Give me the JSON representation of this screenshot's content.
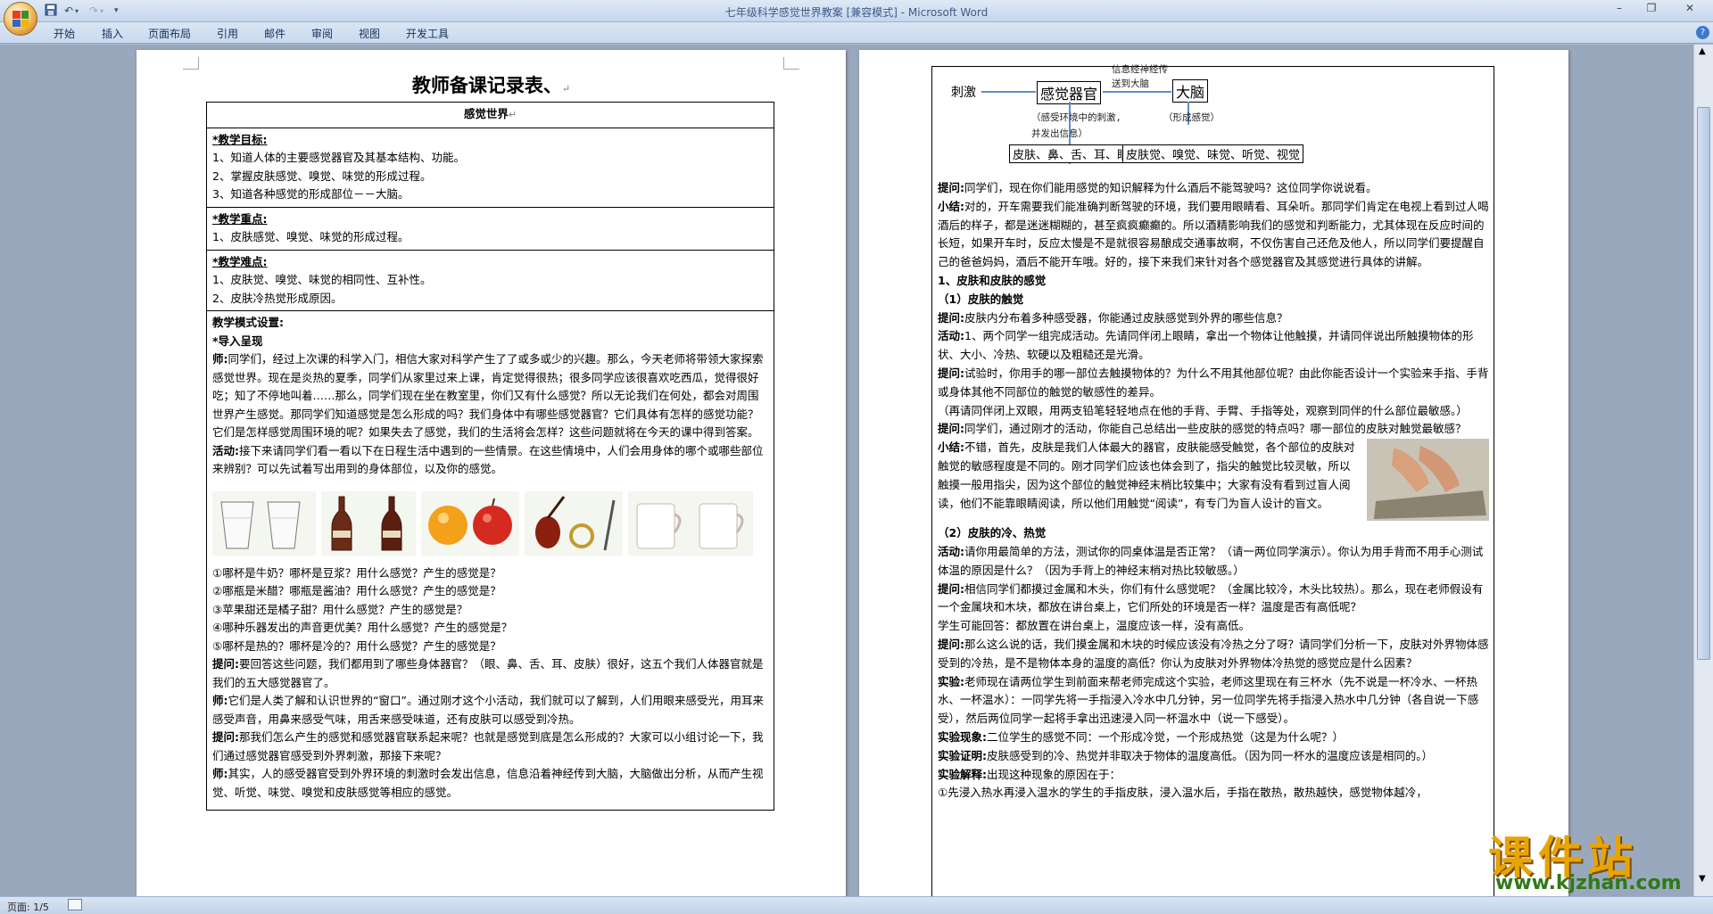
{
  "window": {
    "title": "七年级科学感觉世界教案 [兼容模式] - Microsoft Word"
  },
  "ribbon": {
    "tabs": [
      "开始",
      "插入",
      "页面布局",
      "引用",
      "邮件",
      "审阅",
      "视图",
      "开发工具"
    ]
  },
  "statusbar": {
    "page_info": "页面: 1/5"
  },
  "watermark": {
    "text": "课件站",
    "url": "www.kjzhan.com"
  },
  "page1": {
    "title": "教师备课记录表、",
    "lesson_name": "感觉世界",
    "goals_heading": "*教学目标:",
    "goals": [
      "1、知道人体的主要感觉器官及其基本结构、功能。",
      "2、掌握皮肤感觉、嗅觉、味觉的形成过程。",
      "3、知道各种感觉的形成部位－－大脑。"
    ],
    "key_heading": "*教学重点:",
    "key": [
      "1、皮肤感觉、嗅觉、味觉的形成过程。"
    ],
    "hard_heading": "*教学难点:",
    "hard": [
      "1、皮肤觉、嗅觉、味觉的相同性、互补性。",
      "2、皮肤冷热觉形成原因。"
    ],
    "mode_heading": "教学模式设置:",
    "intro_heading": "*导入呈现",
    "teacher_label": "师:",
    "teacher_1": "同学们，经过上次课的科学入门，相信大家对科学产生了了或多或少的兴趣。那么，今天老师将带领大家探索感觉世界。现在是炎热的夏季，同学们从家里过来上课，肯定觉得很热；很多同学应该很喜欢吃西瓜，觉得很好吃；知了不停地叫着……那么，同学们现在坐在教室里，你们又有什么感觉？所以无论我们在何处，都会对周围世界产生感觉。那同学们知道感觉是怎么形成的吗？我们身体中有哪些感觉器官？它们具体有怎样的感觉功能？它们是怎样感觉周围环境的呢？如果失去了感觉，我们的生活将会怎样？这些问题就将在今天的课中得到答案。",
    "activity_label": "活动:",
    "activity_1": "接下来请同学们看一看以下在日程生活中遇到的一些情景。在这些情境中，人们会用身体的哪个或哪些部位来辨别？可以先试着写出用到的身体部位，以及你的感觉。",
    "questions": [
      "①哪杯是牛奶？哪杯是豆浆？用什么感觉？产生的感觉是？",
      "②哪瓶是米醋？哪瓶是酱油？用什么感觉？产生的感觉是？",
      "③苹果甜还是橘子甜？用什么感觉？产生的感觉是？",
      "④哪种乐器发出的声音更优美？用什么感觉？产生的感觉是？",
      "⑤哪杯是热的？哪杯是冷的？用什么感觉？产生的感觉是？"
    ],
    "ask_label": "提问:",
    "ask_1": "要回答这些问题，我们都用到了哪些身体器官？（眼、鼻、舌、耳、皮肤）很好，这五个我们人体器官就是我们的五大感觉器官了。",
    "teacher_2": "它们是人类了解和认识世界的“窗口”。通过刚才这个小活动，我们就可以了解到，人们用眼来感受光，用耳来感受声音，用鼻来感受气味，用舌来感受味道，还有皮肤可以感受到冷热。",
    "ask_2": "那我们怎么产生的感觉和感觉器官联系起来呢？也就是感觉到底是怎么形成的？大家可以小组讨论一下，我们通过感觉器官感受到外界刺激，那接下来呢？",
    "teacher_3": "其实，人的感受器官受到外界环境的刺激时会发出信息，信息沿着神经传到大脑，大脑做出分析，从而产生视觉、听觉、味觉、嗅觉和皮肤感觉等相应的感觉。"
  },
  "page2": {
    "diagram": {
      "top_label_1": "信息经神经传",
      "top_label_2": "送到大脑",
      "stimulus": "刺激",
      "organ": "感觉器官",
      "brain": "大脑",
      "sub_1": "（感受环境中的刺激,",
      "sub_2": "并发出信息）",
      "sub_3": "（形成感觉）",
      "organs_list": "皮肤、鼻、舌、耳、眼",
      "senses_list": "皮肤觉、嗅觉、味觉、听觉、视觉"
    },
    "ask_label": "提问:",
    "summary_label": "小结:",
    "activity_label": "活动:",
    "exp_label": "实验:",
    "phen_label": "实验现象:",
    "proof_label": "实验证明:",
    "expl_label": "实验解释:",
    "p_ask_1": "同学们，现在你们能用感觉的知识解释为什么酒后不能驾驶吗？这位同学你说说看。",
    "p_sum_1": "对的，开车需要我们能准确判断驾驶的环境，我们要用眼睛看、耳朵听。那同学们肯定在电视上看到过人喝酒后的样子，都是迷迷糊糊的，甚至疯疯癫癫的。所以酒精影响我们的感觉和判断能力，尤其体现在反应时间的长短，如果开车时，反应太慢是不是就很容易酿成交通事故啊，不仅伤害自己还危及他人，所以同学们要提醒自己的爸爸妈妈，酒后不能开车哦。好的，接下来我们来针对各个感觉器官及其感觉进行具体的讲解。",
    "h_skin": "1、皮肤和皮肤的感觉",
    "h_touch": "（1）皮肤的触觉",
    "p_ask_2": "皮肤内分布着多种感受器，你能通过皮肤感觉到外界的哪些信息？",
    "p_act_1": "1、两个同学一组完成活动。先请同伴闭上眼睛，拿出一个物体让他触摸，并请同伴说出所触摸物体的形状、大小、冷热、软硬以及粗糙还是光滑。",
    "p_ask_3": "试验时，你用手的哪一部位去触摸物体的？为什么不用其他部位呢？由此你能否设计一个实验来手指、手背或身体其他不同部位的触觉的敏感性的差异。",
    "p_paren": "（再请同伴闭上双眼，用两支铅笔轻轻地点在他的手背、手臂、手指等处，观察到同伴的什么部位最敏感。）",
    "p_ask_4": "同学们，通过刚才的活动，你能自己总结出一些皮肤的感觉的特点吗？哪一部位的皮肤对触觉最敏感？",
    "p_sum_2": "不错，首先，皮肤是我们人体最大的器官，皮肤能感受触觉，各个部位的皮肤对触觉的敏感程度是不同的。刚才同学们应该也体会到了，指尖的触觉比较灵敏，所以触摸一般用指尖，因为这个部位的触觉神经末梢比较集中；大家有没有看到过盲人阅读，他们不能靠眼睛阅读，所以他们用触觉“阅读”，有专门为盲人设计的盲文。",
    "h_temp": "（2）皮肤的冷、热觉",
    "p_act_2": "请你用最简单的方法，测试你的同桌体温是否正常？（请一两位同学演示）。你认为用手背而不用手心测试体温的原因是什么？（因为手背上的神经末梢对热比较敏感。）",
    "p_ask_5": "相信同学们都摸过金属和木头，你们有什么感觉呢？（金属比较冷，木头比较热）。那么，现在老师假设有一个金属块和木块，都放在讲台桌上，它们所处的环境是否一样？温度是否有高低呢？",
    "p_plain": "学生可能回答：都放置在讲台桌上，温度应该一样，没有高低。",
    "p_ask_6": "那么这么说的话，我们摸金属和木块的时候应该没有冷热之分了呀？请同学们分析一下，皮肤对外界物体感受到的冷热，是不是物体本身的温度的高低？你认为皮肤对外界物体冷热觉的感觉应是什么因素？",
    "p_exp": "老师现在请两位学生到前面来帮老师完成这个实验，老师这里现在有三杯水（先不说是一杯冷水、一杯热水、一杯温水）：一同学先将一手指浸入冷水中几分钟，另一位同学先将手指浸入热水中几分钟（各自说一下感受），然后两位同学一起将手拿出迅速浸入同一杯温水中（说一下感受）。",
    "p_phen": "二位学生的感觉不同：一个形成冷觉，一个形成热觉（这是为什么呢？）",
    "p_proof": "皮肤感受到的冷、热觉并非取决于物体的温度高低。（因为同一杯水的温度应该是相同的。）",
    "p_expl": "出现这种现象的原因在于：",
    "p_last": "①先浸入热水再浸入温水的学生的手指皮肤，浸入温水后，手指在散热，散热越快，感觉物体越冷，"
  }
}
